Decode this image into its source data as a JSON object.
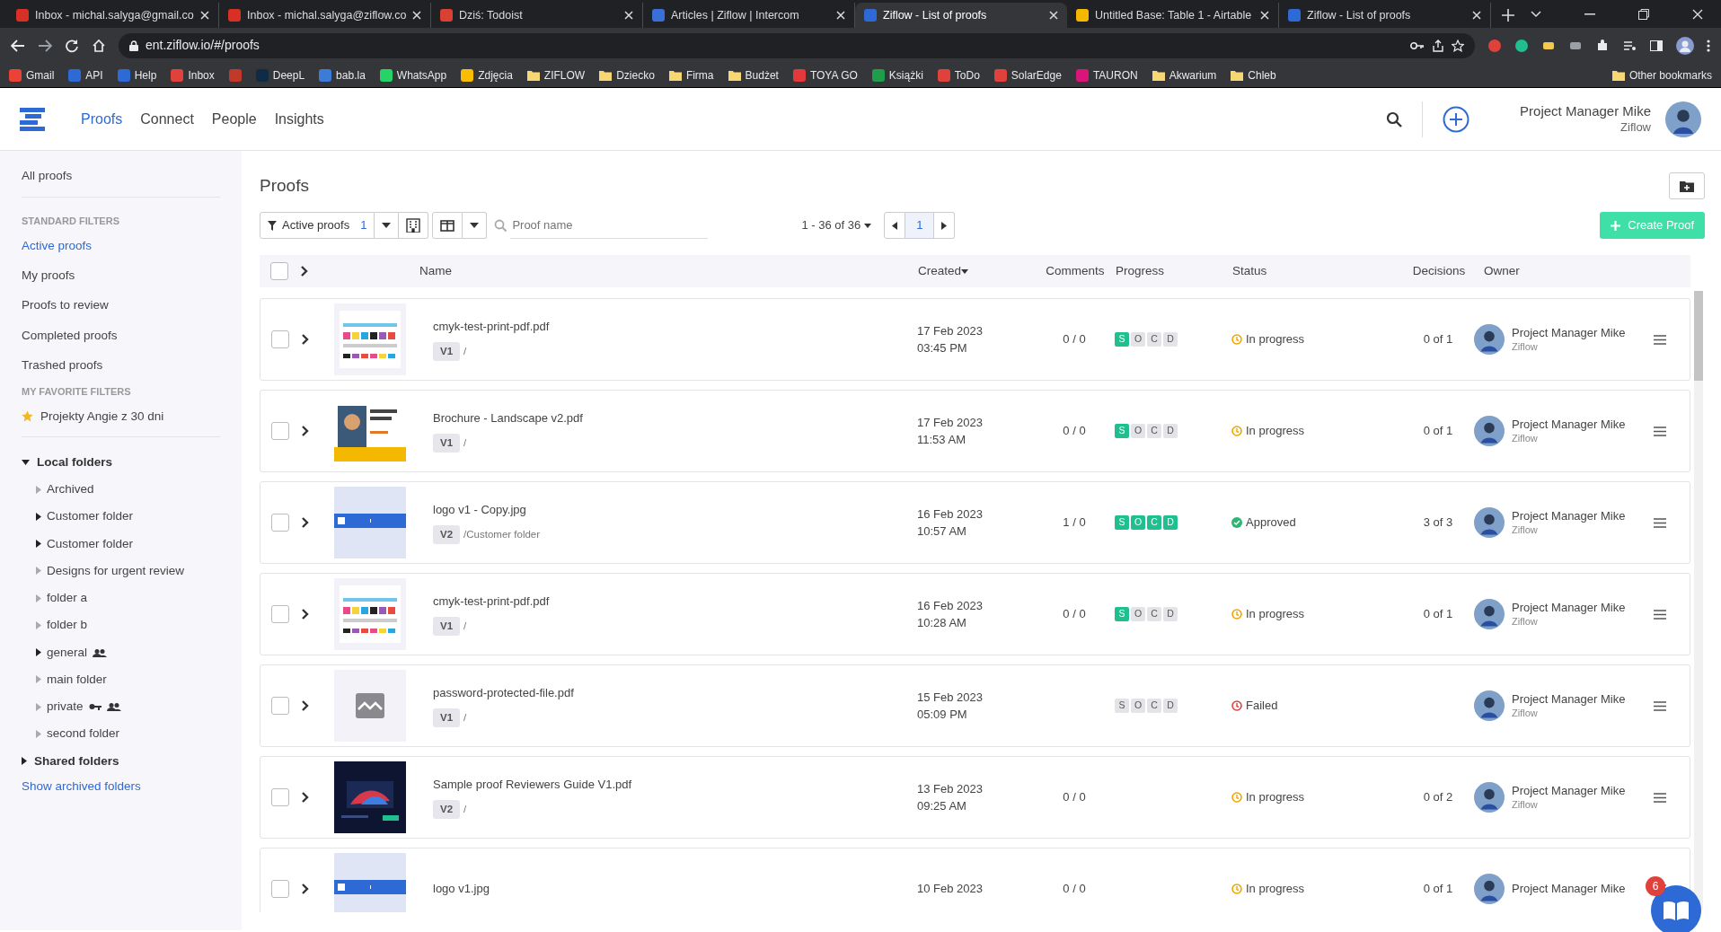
{
  "browser": {
    "tabs": [
      {
        "title": "Inbox - michal.salyga@gmail.co",
        "selected": false,
        "color": "#d93025"
      },
      {
        "title": "Inbox - michal.salyga@ziflow.co",
        "selected": false,
        "color": "#d93025"
      },
      {
        "title": "Dziś: Todoist",
        "selected": false,
        "color": "#db4035"
      },
      {
        "title": "Articles | Ziflow | Intercom",
        "selected": false,
        "color": "#3b6fd8"
      },
      {
        "title": "Ziflow - List of proofs",
        "selected": true,
        "color": "#2d6ad6"
      },
      {
        "title": "Untitled Base: Table 1 - Airtable",
        "selected": false,
        "color": "#f5b800"
      },
      {
        "title": "Ziflow - List of proofs",
        "selected": false,
        "color": "#2d6ad6"
      }
    ],
    "url": "ent.ziflow.io/#/proofs",
    "bookmarks": [
      {
        "label": "Gmail",
        "kind": "site",
        "color": "#ea4335"
      },
      {
        "label": "API",
        "kind": "site",
        "color": "#2d6ad6"
      },
      {
        "label": "Help",
        "kind": "site",
        "color": "#2d6ad6"
      },
      {
        "label": "Inbox",
        "kind": "site",
        "color": "#e0413b"
      },
      {
        "kind": "site",
        "color": "#c0392b"
      },
      {
        "label": "DeepL",
        "kind": "site",
        "color": "#0f2b46"
      },
      {
        "label": "bab.la",
        "kind": "site",
        "color": "#3d7bd9"
      },
      {
        "label": "WhatsApp",
        "kind": "site",
        "color": "#25d366"
      },
      {
        "label": "Zdjęcia",
        "kind": "site",
        "color": "#fbbc04"
      },
      {
        "label": "ZIFLOW",
        "kind": "folder"
      },
      {
        "label": "Dziecko",
        "kind": "folder"
      },
      {
        "label": "Firma",
        "kind": "folder"
      },
      {
        "label": "Budżet",
        "kind": "folder"
      },
      {
        "label": "TOYA GO",
        "kind": "site",
        "color": "#e23a3a"
      },
      {
        "label": "Książki",
        "kind": "site",
        "color": "#1e9e4a"
      },
      {
        "label": "ToDo",
        "kind": "site",
        "color": "#e0413b"
      },
      {
        "label": "SolarEdge",
        "kind": "site",
        "color": "#e0413b"
      },
      {
        "label": "TAURON",
        "kind": "site",
        "color": "#d9157a"
      },
      {
        "label": "Akwarium",
        "kind": "folder"
      },
      {
        "label": "Chleb",
        "kind": "folder"
      }
    ],
    "other_bookmarks": "Other bookmarks"
  },
  "app": {
    "nav": [
      {
        "label": "Proofs",
        "selected": true
      },
      {
        "label": "Connect",
        "selected": false
      },
      {
        "label": "People",
        "selected": false
      },
      {
        "label": "Insights",
        "selected": false
      }
    ],
    "user": {
      "name": "Project Manager Mike",
      "org": "Ziflow"
    }
  },
  "sidebar": {
    "all": "All proofs",
    "standard_heading": "STANDARD FILTERS",
    "filters": [
      {
        "label": "Active proofs",
        "selected": true
      },
      {
        "label": "My proofs",
        "selected": false
      },
      {
        "label": "Proofs to review",
        "selected": false
      },
      {
        "label": "Completed proofs",
        "selected": false
      },
      {
        "label": "Trashed proofs",
        "selected": false
      }
    ],
    "favorites_heading": "MY FAVORITE FILTERS",
    "favorites": [
      {
        "label": "Projekty Angie z 30 dni"
      }
    ],
    "folders": [
      {
        "label": "Local folders",
        "expanded": true,
        "children": [
          {
            "label": "Archived",
            "has_children": false,
            "shared": false,
            "locked": false
          },
          {
            "label": "Customer folder",
            "has_children": true,
            "shared": false,
            "locked": false
          },
          {
            "label": "Customer folder",
            "has_children": true,
            "shared": false,
            "locked": false
          },
          {
            "label": "Designs for urgent review",
            "has_children": false,
            "shared": false,
            "locked": false
          },
          {
            "label": "folder a",
            "has_children": false,
            "shared": false,
            "locked": false
          },
          {
            "label": "folder b",
            "has_children": false,
            "shared": false,
            "locked": false
          },
          {
            "label": "general",
            "has_children": true,
            "shared": true,
            "locked": false
          },
          {
            "label": "main folder",
            "has_children": false,
            "shared": false,
            "locked": false
          },
          {
            "label": "private",
            "has_children": false,
            "shared": true,
            "locked": true
          },
          {
            "label": "second folder",
            "has_children": false,
            "shared": false,
            "locked": false
          }
        ]
      },
      {
        "label": "Shared folders",
        "expanded": false
      }
    ],
    "show_archived": "Show archived folders"
  },
  "page": {
    "title": "Proofs",
    "filter": {
      "label": "Active proofs",
      "count": "1"
    },
    "search": {
      "placeholder": "Proof name"
    },
    "range": "1 - 36 of 36",
    "current_page": "1",
    "create": "Create Proof"
  },
  "table": {
    "all_checked": false,
    "columns": [
      {
        "label": "Name",
        "sorted": false
      },
      {
        "label": "Created",
        "sorted": true
      },
      {
        "label": "Comments",
        "sorted": false
      },
      {
        "label": "Progress",
        "sorted": false
      },
      {
        "label": "Status",
        "sorted": false
      },
      {
        "label": "Decisions",
        "sorted": false
      },
      {
        "label": "Owner",
        "sorted": false
      }
    ],
    "rows": [
      {
        "selected": false,
        "expanded": false,
        "thumbnail": {
          "kind": "picture"
        },
        "name": "cmyk-test-print-pdf.pdf",
        "version": "V1",
        "folder": "/",
        "date": "17 Feb 2023",
        "time": "03:45 PM",
        "comments": "0 / 0",
        "stages": [
          {
            "letter": "S",
            "done": true
          },
          {
            "letter": "O",
            "done": false
          },
          {
            "letter": "C",
            "done": false
          },
          {
            "letter": "D",
            "done": false
          }
        ],
        "status": {
          "kind": "in_progress",
          "label": "In progress"
        },
        "decisions": "0 of 1",
        "owner": {
          "name": "Project Manager Mike",
          "org": "Ziflow"
        }
      },
      {
        "selected": false,
        "expanded": false,
        "thumbnail": {
          "kind": "picture"
        },
        "name": "Brochure - Landscape v2.pdf",
        "version": "V1",
        "folder": "/",
        "date": "17 Feb 2023",
        "time": "11:53 AM",
        "comments": "0 / 0",
        "stages": [
          {
            "letter": "S",
            "done": true
          },
          {
            "letter": "O",
            "done": false
          },
          {
            "letter": "C",
            "done": false
          },
          {
            "letter": "D",
            "done": false
          }
        ],
        "status": {
          "kind": "in_progress",
          "label": "In progress"
        },
        "decisions": "0 of 1",
        "owner": {
          "name": "Project Manager Mike",
          "org": "Ziflow"
        }
      },
      {
        "selected": false,
        "expanded": false,
        "thumbnail": {
          "kind": "picture"
        },
        "name": "logo v1 - Copy.jpg",
        "version": "V2",
        "folder": "/Customer folder",
        "date": "16 Feb 2023",
        "time": "10:57 AM",
        "comments": "1 / 0",
        "stages": [
          {
            "letter": "S",
            "done": true
          },
          {
            "letter": "O",
            "done": true
          },
          {
            "letter": "C",
            "done": true
          },
          {
            "letter": "D",
            "done": true
          }
        ],
        "status": {
          "kind": "approved",
          "label": "Approved"
        },
        "decisions": "3 of 3",
        "owner": {
          "name": "Project Manager Mike",
          "org": "Ziflow"
        }
      },
      {
        "selected": false,
        "expanded": false,
        "thumbnail": {
          "kind": "picture"
        },
        "name": "cmyk-test-print-pdf.pdf",
        "version": "V1",
        "folder": "/",
        "date": "16 Feb 2023",
        "time": "10:28 AM",
        "comments": "0 / 0",
        "stages": [
          {
            "letter": "S",
            "done": true
          },
          {
            "letter": "O",
            "done": false
          },
          {
            "letter": "C",
            "done": false
          },
          {
            "letter": "D",
            "done": false
          }
        ],
        "status": {
          "kind": "in_progress",
          "label": "In progress"
        },
        "decisions": "0 of 1",
        "owner": {
          "name": "Project Manager Mike",
          "org": "Ziflow"
        }
      },
      {
        "selected": false,
        "expanded": false,
        "thumbnail": {
          "kind": "placeholder"
        },
        "name": "password-protected-file.pdf",
        "version": "V1",
        "folder": "/",
        "date": "15 Feb 2023",
        "time": "05:09 PM",
        "stages": [
          {
            "letter": "S",
            "done": false
          },
          {
            "letter": "O",
            "done": false
          },
          {
            "letter": "C",
            "done": false
          },
          {
            "letter": "D",
            "done": false
          }
        ],
        "status": {
          "kind": "failed",
          "label": "Failed"
        },
        "owner": {
          "name": "Project Manager Mike",
          "org": "Ziflow"
        }
      },
      {
        "selected": false,
        "expanded": false,
        "thumbnail": {
          "kind": "picture"
        },
        "name": "Sample proof Reviewers Guide V1.pdf",
        "version": "V2",
        "folder": "/",
        "date": "13 Feb 2023",
        "time": "09:25 AM",
        "comments": "0 / 0",
        "status": {
          "kind": "in_progress",
          "label": "In progress"
        },
        "decisions": "0 of 2",
        "owner": {
          "name": "Project Manager Mike",
          "org": "Ziflow"
        }
      },
      {
        "selected": false,
        "expanded": false,
        "thumbnail": {
          "kind": "picture"
        },
        "name": "logo v1.jpg",
        "date": "10 Feb 2023",
        "comments": "0 / 0",
        "status": {
          "kind": "in_progress",
          "label": "In progress"
        },
        "decisions": "0 of 1",
        "owner": {
          "name": "Project Manager Mike"
        }
      }
    ]
  },
  "help_badge": "6"
}
